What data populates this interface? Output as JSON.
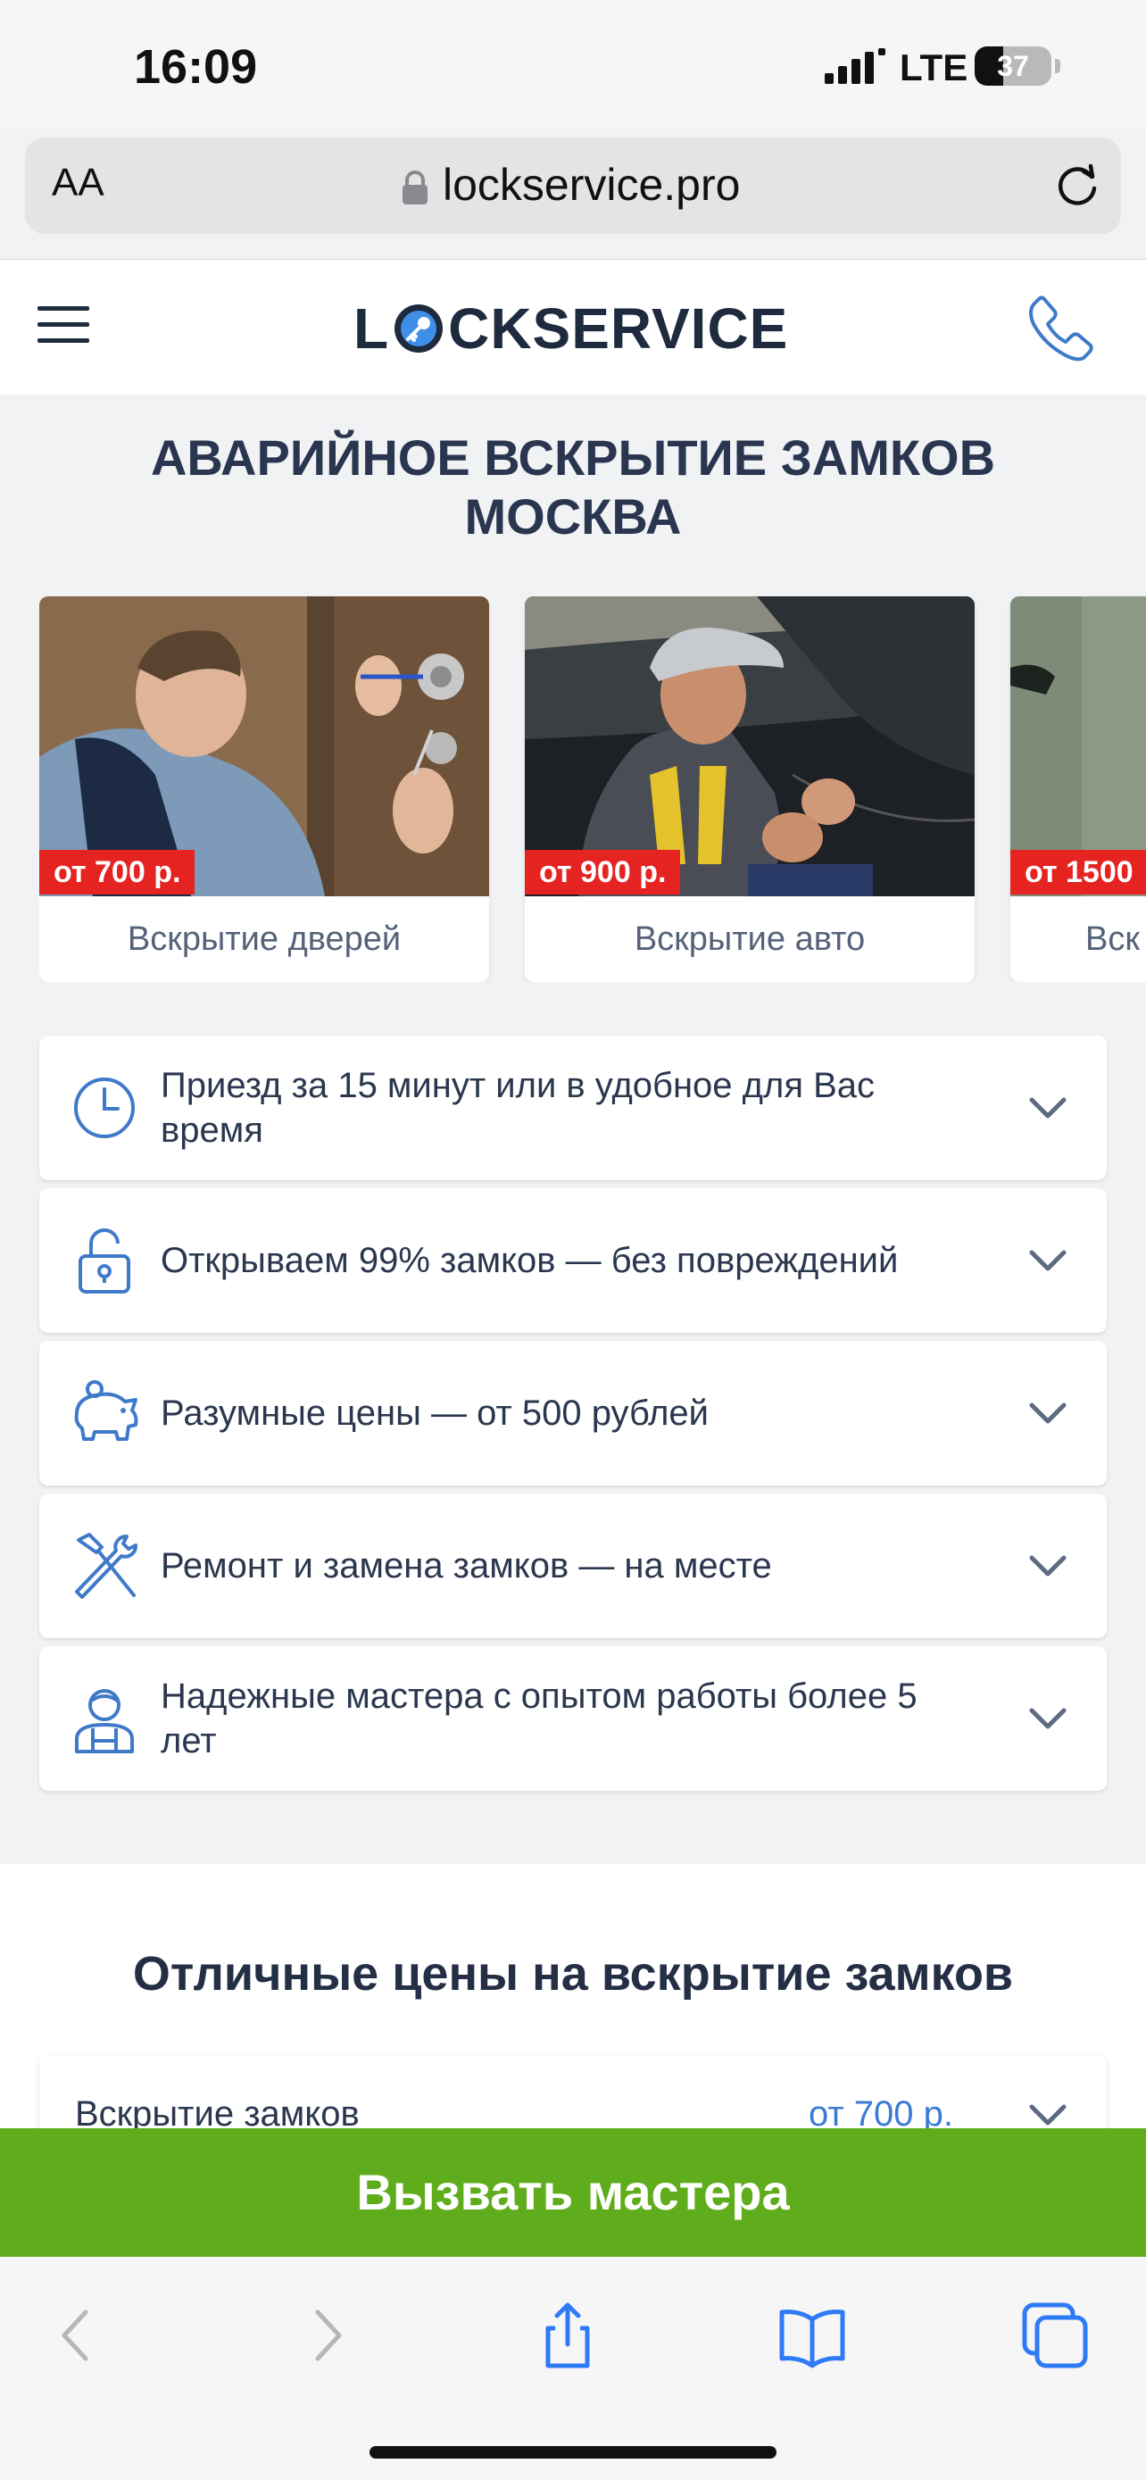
{
  "status_bar": {
    "time": "16:09",
    "network": "LTE",
    "battery": "37",
    "battery_level": 0.37
  },
  "browser": {
    "aa_label": "AA",
    "url": "lockservice.pro"
  },
  "header": {
    "logo_prefix": "L",
    "logo_suffix": "CKSERVICE"
  },
  "hero": {
    "title_line1": "АВАРИЙНОЕ ВСКРЫТИЕ ЗАМКОВ",
    "title_line2": "МОСКВА"
  },
  "services": [
    {
      "price": "от 700 р.",
      "label": "Вскрытие дверей"
    },
    {
      "price": "от 900 р.",
      "label": "Вскрытие авто"
    },
    {
      "price": "от 1500",
      "label": "Вск"
    }
  ],
  "features": [
    {
      "icon": "clock-icon",
      "text": "Приезд за 15 минут или в удобное для Вас время"
    },
    {
      "icon": "unlocked-padlock-icon",
      "text": "Открываем 99% замков — без повреждений"
    },
    {
      "icon": "piggy-bank-icon",
      "text": "Разумные цены — от 500 рублей"
    },
    {
      "icon": "hammer-wrench-icon",
      "text": "Ремонт и замена замков — на месте"
    },
    {
      "icon": "worker-icon",
      "text": "Надежные мастера с опытом работы более 5 лет"
    }
  ],
  "prices": {
    "title": "Отличные цены на вскрытие замков",
    "first_row_label": "Вскрытие замков",
    "first_row_price": "от 700 р."
  },
  "cta": {
    "label": "Вызвать мастера"
  },
  "colors": {
    "accent_green": "#5fad1c",
    "price_red": "#e52321",
    "link_blue": "#3b7bd6",
    "icon_blue": "#3f7ac9"
  }
}
